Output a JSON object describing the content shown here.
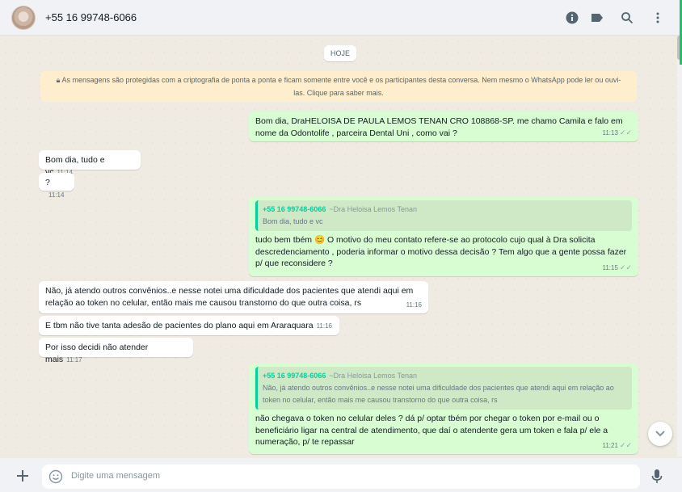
{
  "header": {
    "contact_name": "+55 16 99748-6066"
  },
  "icons": {
    "info": "info-icon",
    "label": "label-icon",
    "search": "search-icon",
    "menu": "menu-icon",
    "attach": "plus-icon",
    "emoji": "emoji-icon",
    "mic": "mic-icon",
    "scroll_down": "chevron-down-icon"
  },
  "chat": {
    "date_chip": "HOJE",
    "encryption_notice": "As mensagens são protegidas com a criptografia de ponta a ponta e ficam somente entre você e os participantes desta conversa. Nem mesmo o WhatsApp pode ler ou ouvi-las. Clique para saber mais.",
    "messages": [
      {
        "dir": "out",
        "text": "Bom dia, DraHELOISA DE PAULA LEMOS TENAN CRO 108868-SP. me chamo Camila e falo em nome da Odontolife , parceira Dental Uni , como vai ?",
        "time": "11:13"
      },
      {
        "dir": "in",
        "text": "Bom dia, tudo e vc",
        "time": "11:14"
      },
      {
        "dir": "in",
        "text": "?",
        "time": "11:14"
      },
      {
        "dir": "out",
        "quote_author": "+55 16 99748-6066",
        "quote_name": "~Dra Heloisa Lemos Tenan",
        "quote_text": "Bom dia, tudo e vc",
        "text": "tudo bem tbém 😊 O motivo do meu contato refere-se ao protocolo cujo qual à Dra solicita descredenciamento , poderia informar o motivo dessa decisão ? Tem algo que a gente possa fazer p/ que reconsidere ?",
        "time": "11:15"
      },
      {
        "dir": "in",
        "text": "Não, já atendo outros convênios..e nesse notei uma dificuldade dos pacientes que atendi aqui em relação ao token no celular, então mais me causou transtorno do que outra coisa, rs",
        "time": "11:16"
      },
      {
        "dir": "in",
        "text": "E tbm não tive tanta adesão de pacientes do plano aqui em Araraquara",
        "time": "11:16"
      },
      {
        "dir": "in",
        "text": "Por isso decidi não atender mais",
        "time": "11:17"
      },
      {
        "dir": "out",
        "quote_author": "+55 16 99748-6066",
        "quote_name": "~Dra Heloisa Lemos Tenan",
        "quote_text": "Não, já atendo outros convênios..e nesse notei uma dificuldade dos pacientes que atendi aqui em relação ao token no celular, então mais me causou transtorno do que outra coisa, rs",
        "text": "não chegava o token no celular deles ?  dá p/ optar tbém por chegar o token por e-mail ou o beneficiário ligar na central de atendimento, que daí o atendente gera um token e fala p/ ele a numeração, p/ te repassar",
        "time": "11:21"
      }
    ]
  },
  "composer": {
    "placeholder": "Digite uma mensagem"
  }
}
